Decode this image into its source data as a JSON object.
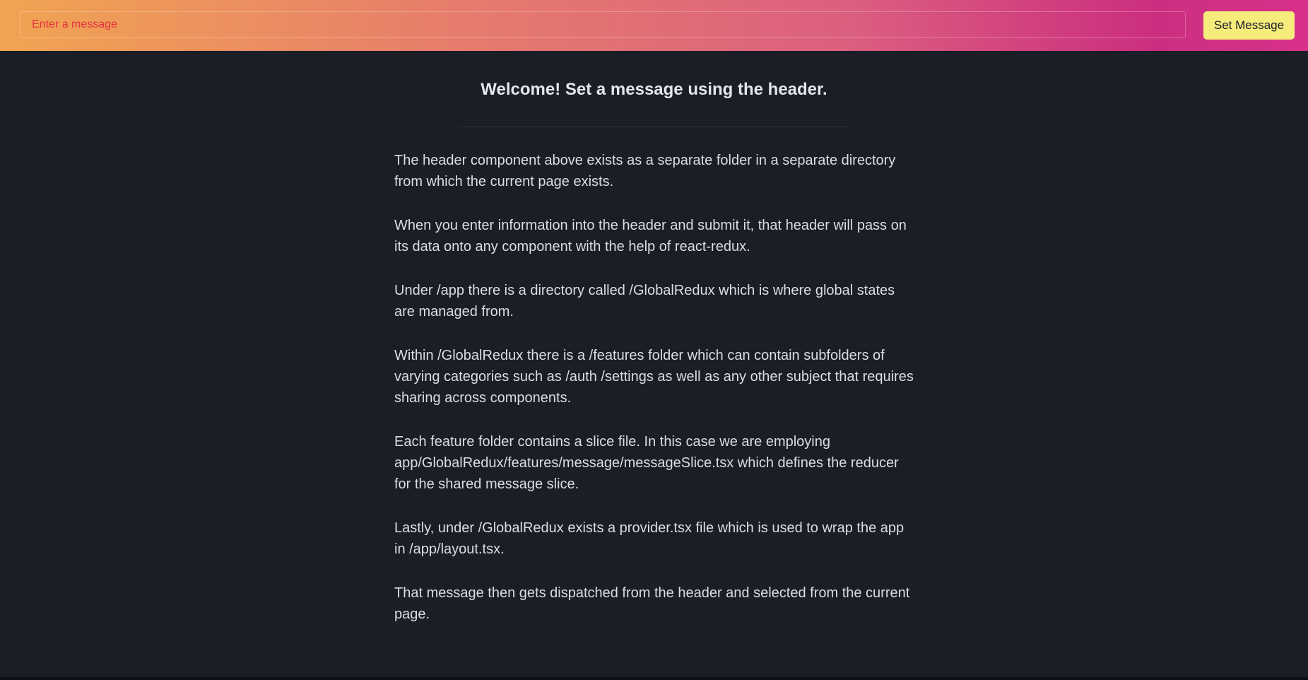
{
  "header": {
    "input_placeholder": "Enter a message",
    "input_value": "",
    "button_label": "Set Message",
    "gradient_colors": [
      "#f0a552",
      "#e77c6c",
      "#db5f7f",
      "#cc2f7f"
    ],
    "button_color": "#f6ec7c"
  },
  "main": {
    "title": "Welcome! Set a message using the header.",
    "paragraphs": [
      "The header component above exists as a separate folder in a separate directory from which the current page exists.",
      "When you enter information into the header and submit it, that header will pass on its data onto any component with the help of react-redux.",
      "Under /app there is a directory called /GlobalRedux which is where global states are managed from.",
      "Within /GlobalRedux there is a /features folder which can contain subfolders of varying categories such as /auth /settings as well as any other subject that requires sharing across components.",
      "Each feature folder contains a slice file. In this case we are employing app/GlobalRedux/features/message/messageSlice.tsx which defines the reducer for the shared message slice.",
      "Lastly, under /GlobalRedux exists a provider.tsx file which is used to wrap the app in /app/layout.tsx.",
      "That message then gets dispatched from the header and selected from the current page."
    ]
  },
  "theme": {
    "background": "#1b1d27",
    "text": "#dcdde3"
  }
}
